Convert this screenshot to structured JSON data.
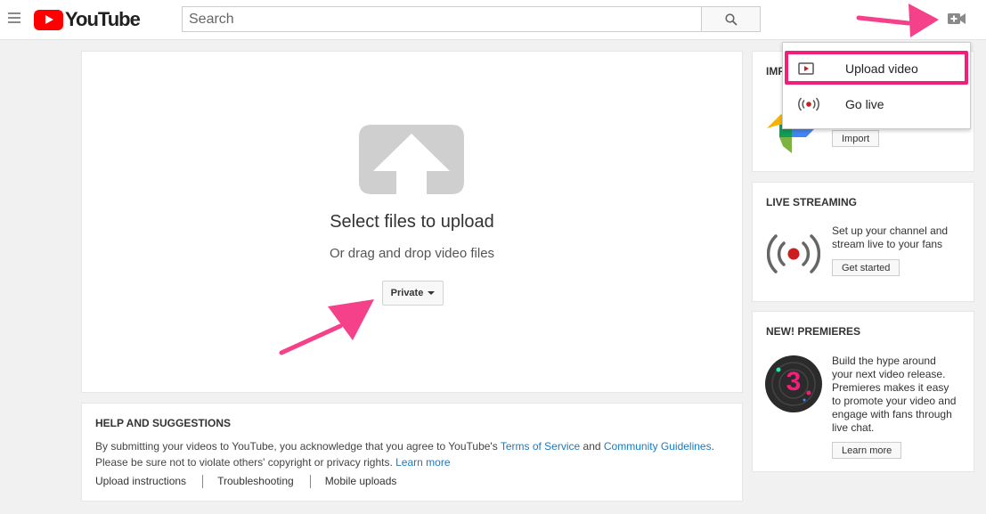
{
  "header": {
    "logo_text": "YouTube",
    "search_placeholder": "Search"
  },
  "dropdown": {
    "items": [
      {
        "label": "Upload video",
        "icon": "upload-video-icon"
      },
      {
        "label": "Go live",
        "icon": "go-live-icon"
      }
    ]
  },
  "upload": {
    "title": "Select files to upload",
    "subtitle": "Or drag and drop video files",
    "privacy_label": "Private"
  },
  "help": {
    "title": "HELP AND SUGGESTIONS",
    "text_1": "By submitting your videos to YouTube, you acknowledge that you agree to YouTube's ",
    "link_terms": "Terms of Service",
    "text_and": " and ",
    "link_guidelines": "Community Guidelines",
    "text_2": ". Please be sure not to violate others' copyright or privacy rights. ",
    "link_learn": "Learn more",
    "links": [
      "Upload instructions",
      "Troubleshooting",
      "Mobile uploads"
    ]
  },
  "sidebar": {
    "import": {
      "title_partial": "IMP",
      "button": "Import"
    },
    "live": {
      "title": "LIVE STREAMING",
      "text": "Set up your channel and stream live to your fans",
      "button": "Get started"
    },
    "premieres": {
      "title": "NEW! PREMIERES",
      "text": "Build the hype around your next video release. Premieres makes it easy to promote your video and engage with fans through live chat.",
      "button": "Learn more",
      "badge_number": "3"
    }
  },
  "colors": {
    "brand_red": "#ff0000",
    "highlight_pink": "#f0207a",
    "link_blue": "#167ac6",
    "live_red": "#cc1e1e"
  }
}
